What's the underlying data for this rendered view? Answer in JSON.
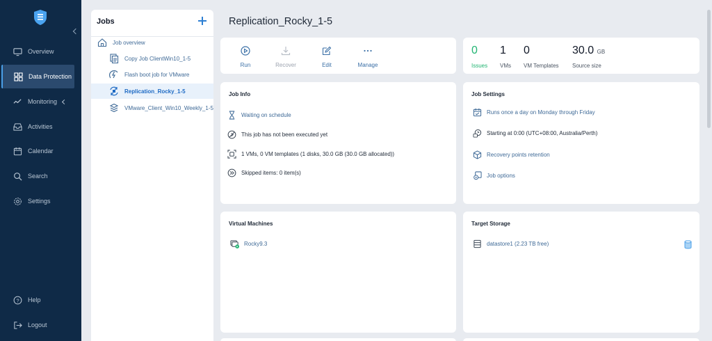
{
  "sidebar": {
    "items": [
      {
        "label": "Overview",
        "icon": "monitor-icon"
      },
      {
        "label": "Data Protection",
        "icon": "grid-icon"
      },
      {
        "label": "Monitoring",
        "icon": "pulse-icon"
      },
      {
        "label": "Activities",
        "icon": "inbox-icon"
      },
      {
        "label": "Calendar",
        "icon": "calendar-icon"
      },
      {
        "label": "Search",
        "icon": "search-icon"
      },
      {
        "label": "Settings",
        "icon": "gear-icon"
      }
    ],
    "bottom": [
      {
        "label": "Help",
        "icon": "help-icon"
      },
      {
        "label": "Logout",
        "icon": "logout-icon"
      }
    ],
    "active_index": 1
  },
  "jobs": {
    "title": "Jobs",
    "overview_label": "Job overview",
    "items": [
      {
        "label": "Copy Job ClientWin10_1-5",
        "icon": "copy-job-icon"
      },
      {
        "label": "Flash boot job for VMware",
        "icon": "flash-boot-icon"
      },
      {
        "label": "Replication_Rocky_1-5",
        "icon": "replication-icon",
        "selected": true
      },
      {
        "label": "VMware_Client_Win10_Weekly_1-5",
        "icon": "backup-job-icon"
      }
    ]
  },
  "page": {
    "title": "Replication_Rocky_1-5"
  },
  "actions": [
    {
      "label": "Run",
      "icon": "play-icon",
      "enabled": true
    },
    {
      "label": "Recover",
      "icon": "download-icon",
      "enabled": false
    },
    {
      "label": "Edit",
      "icon": "edit-icon",
      "enabled": true
    },
    {
      "label": "Manage",
      "icon": "more-icon",
      "enabled": true
    }
  ],
  "stats": [
    {
      "value": "0",
      "label": "Issues",
      "color": "#22b573"
    },
    {
      "value": "1",
      "label": "VMs"
    },
    {
      "value": "0",
      "label": "VM Templates"
    },
    {
      "value": "30.0",
      "unit": "GB",
      "label": "Source size"
    }
  ],
  "job_info": {
    "title": "Job Info",
    "rows": [
      {
        "text": "Waiting on schedule",
        "icon": "hourglass-icon",
        "link": true
      },
      {
        "text": "This job has not been executed yet",
        "icon": "no-run-icon",
        "link": false
      },
      {
        "text": "1 VMs, 0 VM templates (1 disks, 30.0 GB (30.0 GB allocated))",
        "icon": "vm-scan-icon",
        "link": false
      },
      {
        "text": "Skipped items: 0 item(s)",
        "icon": "skip-icon",
        "link": false
      }
    ]
  },
  "job_settings": {
    "title": "Job Settings",
    "rows": [
      {
        "text": "Runs once a day on Monday through Friday",
        "icon": "schedule-icon",
        "link": true
      },
      {
        "text": "Starting at 0:00 (UTC+08:00, Australia/Perth)",
        "icon": "clock-icon",
        "link": false
      },
      {
        "text": "Recovery points retention",
        "icon": "retention-icon",
        "link": true
      },
      {
        "text": "Job options",
        "icon": "options-icon",
        "link": true
      }
    ]
  },
  "virtual_machines": {
    "title": "Virtual Machines",
    "items": [
      {
        "text": "Rocky9.3",
        "icon": "vm-running-icon"
      }
    ]
  },
  "target_storage": {
    "title": "Target Storage",
    "items": [
      {
        "text": "datastore1 (2.23 TB free)",
        "icon": "datastore-icon"
      }
    ]
  },
  "colors": {
    "sidebar_bg": "#0f2a47",
    "accent": "#2d7fd3",
    "link": "#3f6a97",
    "success": "#22b573"
  }
}
